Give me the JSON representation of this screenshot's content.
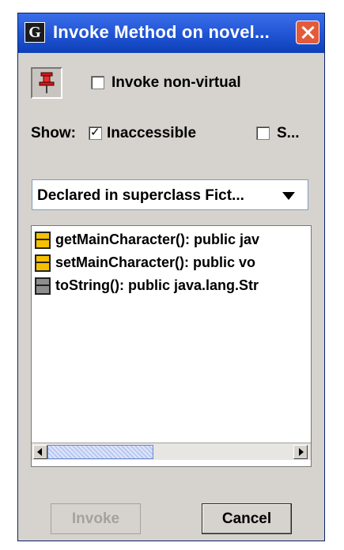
{
  "window": {
    "title": "Invoke Method on novel...",
    "app_icon_letter": "G"
  },
  "options": {
    "invoke_nonvirtual_label": "Invoke non-virtual",
    "invoke_nonvirtual_checked": false,
    "show_label": "Show:",
    "inaccessible_label": "Inaccessible",
    "inaccessible_checked": true,
    "static_label": "S...",
    "static_checked": false,
    "check_glyph": "✓"
  },
  "filter": {
    "selected": "Declared in superclass Fict..."
  },
  "methods": [
    {
      "text": "getMainCharacter():  public jav",
      "icon": "method-yellow-icon"
    },
    {
      "text": "setMainCharacter():  public vo",
      "icon": "method-yellow-icon"
    },
    {
      "text": "toString():  public java.lang.Str",
      "icon": "method-gray-icon"
    }
  ],
  "buttons": {
    "invoke_label": "Invoke",
    "cancel_label": "Cancel"
  },
  "colors": {
    "titlebar": "#245edb",
    "window_bg": "#d6d3ce",
    "icon_yellow": "#f5c000",
    "icon_gray": "#8e8e8e",
    "close_button": "#e35a3a"
  }
}
